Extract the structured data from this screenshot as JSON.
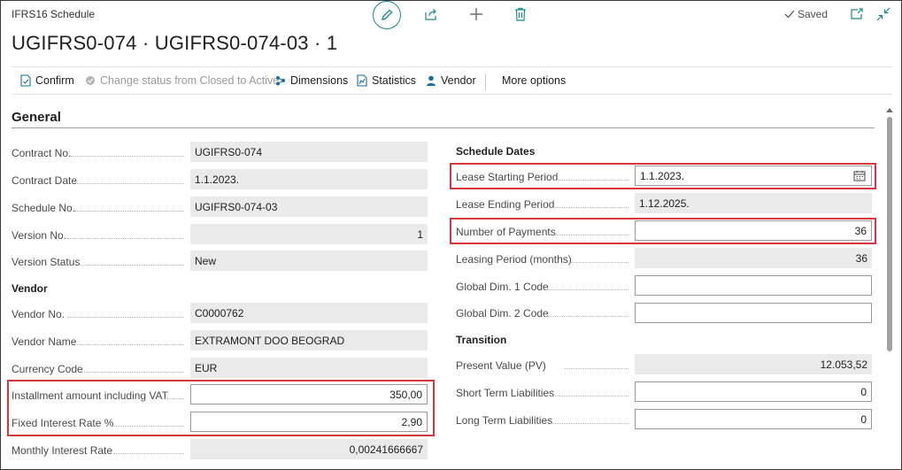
{
  "header": {
    "breadcrumb": "IFRS16 Schedule",
    "title": "UGIFRS0-074 · UGIFRS0-074-03 · 1",
    "saved_label": "Saved"
  },
  "actions": {
    "confirm": "Confirm",
    "change_status": "Change status from Closed to Active",
    "dimensions": "Dimensions",
    "statistics": "Statistics",
    "vendor": "Vendor",
    "more_options": "More options"
  },
  "section": {
    "title": "General"
  },
  "left": {
    "contract_no": {
      "label": "Contract No.",
      "value": "UGIFRS0-074"
    },
    "contract_date": {
      "label": "Contract Date",
      "value": "1.1.2023."
    },
    "schedule_no": {
      "label": "Schedule No.",
      "value": "UGIFRS0-074-03"
    },
    "version_no": {
      "label": "Version No.",
      "value": "1"
    },
    "version_status": {
      "label": "Version Status",
      "value": "New"
    },
    "vendor_group": "Vendor",
    "vendor_no": {
      "label": "Vendor No.",
      "value": "C0000762"
    },
    "vendor_name": {
      "label": "Vendor Name",
      "value": "EXTRAMONT DOO BEOGRAD"
    },
    "currency_code": {
      "label": "Currency Code",
      "value": "EUR"
    },
    "installment": {
      "label": "Installment amount including VAT",
      "value": "350,00"
    },
    "fixed_rate": {
      "label": "Fixed Interest Rate %",
      "value": "2,90"
    },
    "monthly_rate": {
      "label": "Monthly Interest Rate",
      "value": "0,00241666667"
    }
  },
  "right": {
    "schedule_group": "Schedule Dates",
    "lease_start": {
      "label": "Lease Starting Period",
      "value": "1.1.2023."
    },
    "lease_end": {
      "label": "Lease Ending Period",
      "value": "1.12.2025."
    },
    "num_payments": {
      "label": "Number of Payments",
      "value": "36"
    },
    "leasing_period": {
      "label": "Leasing Period (months)",
      "value": "36"
    },
    "global_dim1": {
      "label": "Global Dim. 1 Code",
      "value": ""
    },
    "global_dim2": {
      "label": "Global Dim. 2 Code",
      "value": ""
    },
    "transition_group": "Transition",
    "present_value": {
      "label": "Present Value (PV)",
      "value": "12.053,52"
    },
    "short_term": {
      "label": "Short Term Liabilities",
      "value": "0"
    },
    "long_term": {
      "label": "Long Term Liabilities",
      "value": "0"
    }
  },
  "colors": {
    "accent": "#1a8a8a",
    "highlight": "#d9363e",
    "readonly_bg": "#eaeaea"
  }
}
